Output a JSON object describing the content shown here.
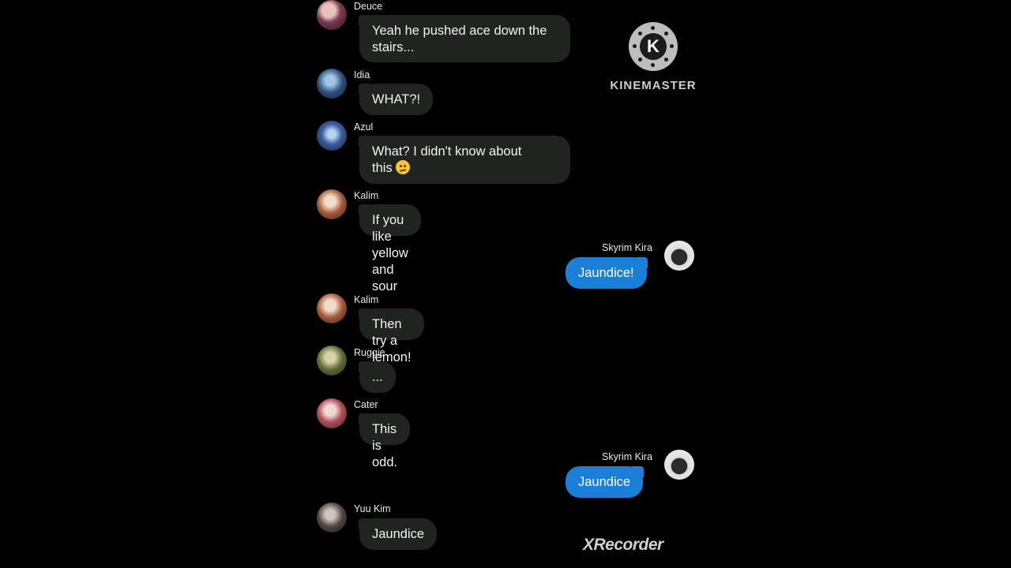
{
  "watermarks": {
    "kinemaster_letter": "K",
    "kinemaster": "KINEMASTER",
    "xrecorder": "XRecorder"
  },
  "colors": {
    "background": "#000000",
    "incoming_bubble": "#1f2420",
    "outgoing_bubble": "#1a7fd6",
    "text": "#f2f2f2"
  },
  "messages": [
    {
      "sender": "Deuce",
      "line1": "Yeah he pushed ace down the",
      "line2": "stairs..."
    },
    {
      "sender": "Idia",
      "text": "WHAT?!"
    },
    {
      "sender": "Azul",
      "line1": "What? I didn't know about",
      "line2": "this",
      "emoji": "confused-face"
    },
    {
      "sender": "Kalim",
      "text": "If you like yellow and sour"
    },
    {
      "sender": "Skyrim Kira",
      "text": "Jaundice!"
    },
    {
      "sender": "Kalim",
      "text": "Then try a lemon!"
    },
    {
      "sender": "Ruggie",
      "text": "..."
    },
    {
      "sender": "Cater",
      "text": "This is odd."
    },
    {
      "sender": "Skyrim Kira",
      "text": "Jaundice"
    },
    {
      "sender": "Yuu Kim",
      "text": "Jaundice"
    }
  ]
}
